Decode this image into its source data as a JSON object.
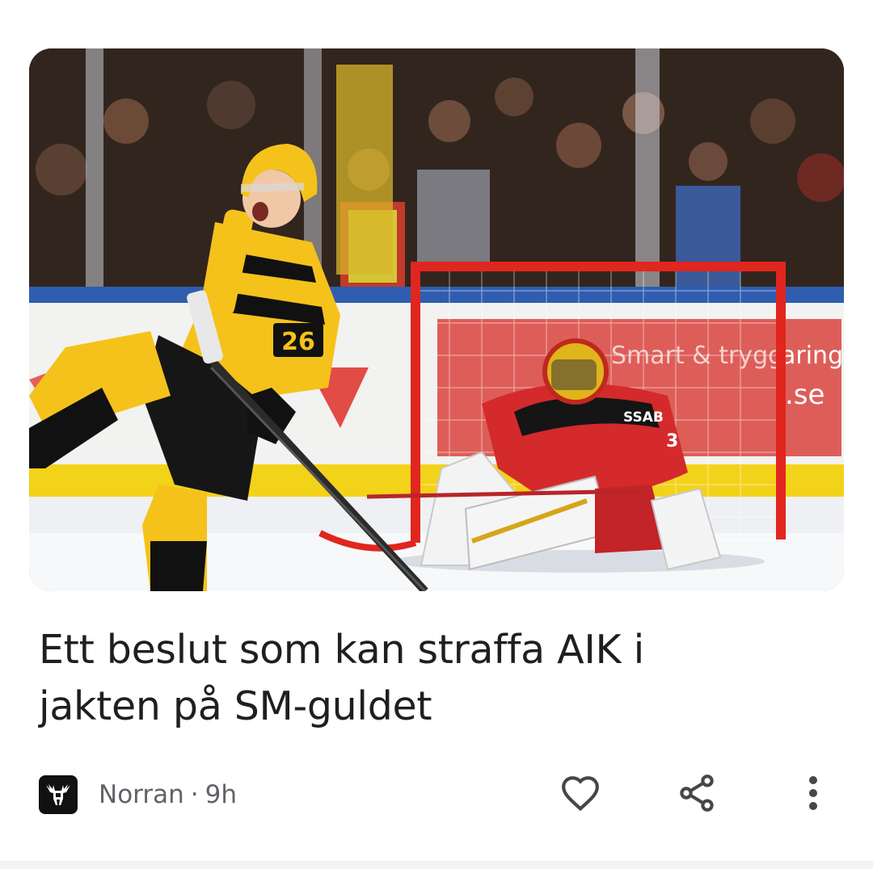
{
  "article": {
    "headline_line1": "Ett beslut som kan straffa AIK i",
    "headline_line2": "jakten på SM-guldet",
    "source": "Norran",
    "separator": "·",
    "age": "9h",
    "image": {
      "player_number": "26",
      "sponsor_text": "SSAB",
      "goalie_number": "3",
      "board_text_1": "Smart & trygg",
      "board_text_2": "aring",
      "board_text_3": ".se"
    }
  },
  "icons": {
    "source_logo": "moose-logo-icon",
    "like": "heart-outline-icon",
    "share": "share-icon",
    "more": "more-vertical-icon"
  },
  "colors": {
    "headline": "#1f1f1f",
    "meta": "#5f6368",
    "icon": "#444746",
    "divider": "#f1f3f4",
    "aik_yellow": "#f7c21a",
    "lulea_red": "#d7262b"
  }
}
